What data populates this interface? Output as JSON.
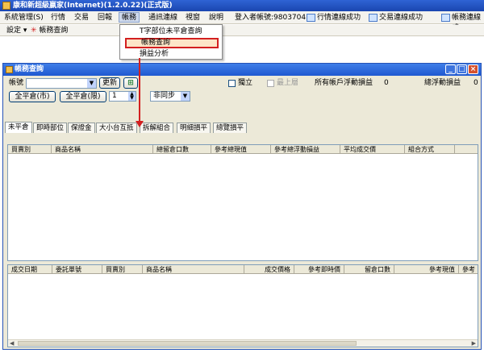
{
  "app": {
    "title": "康和新超級嬴家(Internet)(1.2.0.22)(正式版)"
  },
  "menubar": {
    "items": [
      "系統管理(S)",
      "行情",
      "交易",
      "回報",
      "帳務",
      "通訊連線",
      "視窗",
      "說明"
    ],
    "login_label": "登入者帳號:9803704",
    "status_quote": "行情連線成功",
    "status_trade": "交易連線成功",
    "status_account": "帳務連線成"
  },
  "toolbar": {
    "settings": "設定",
    "settings_arrow": "▾",
    "account_query": "帳務查詢"
  },
  "dropdown": {
    "items": [
      "T字部位未平倉查詢",
      "帳務查詢",
      "損益分析"
    ]
  },
  "inner_window": {
    "title": "帳務查詢",
    "controls": {
      "min": "_",
      "max": "□",
      "close": "×"
    }
  },
  "form": {
    "account_label": "帳號",
    "account_value": "",
    "refresh_button": "更新",
    "excel_button": "⊞",
    "close_all_market": "全平倉(市)",
    "close_all_limit": "全平倉(限)",
    "qty_value": "1",
    "sync_value": "非同步",
    "independent_label": "獨立",
    "top_label": "最上層",
    "all_float_pl_label": "所有帳戶浮動損益",
    "all_float_pl_value": "0",
    "total_float_pl_label": "總浮動損益",
    "total_float_pl_value": "0"
  },
  "tabs": [
    "未平倉",
    "即時部位",
    "保證金",
    "大小台互抵",
    "拆解組合",
    "明細損平",
    "總覽損平"
  ],
  "top_grid": {
    "columns": [
      "買賣別",
      "商品名稱",
      "總留倉口數",
      "參考總現值",
      "參考總浮動損益",
      "平均成交價",
      "組合方式"
    ]
  },
  "bottom_grid": {
    "columns": [
      "成交日期",
      "委託單號",
      "買賣別",
      "商品名稱",
      "成交價格",
      "參考即時價",
      "留倉口數",
      "參考現值",
      "參考"
    ]
  },
  "colors": {
    "highlight": "#d32020",
    "title_blue": "#1f58d0"
  }
}
